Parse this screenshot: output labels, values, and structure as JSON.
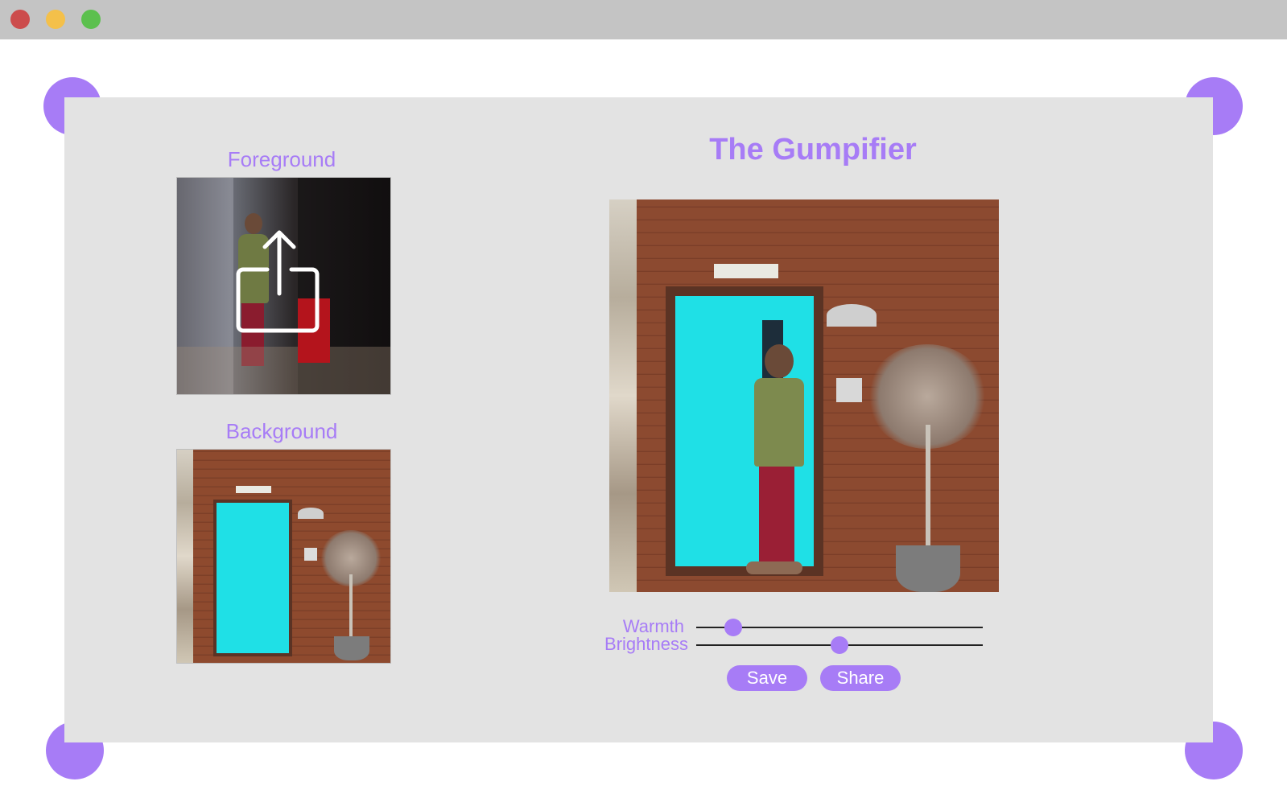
{
  "window": {
    "controls": [
      "close",
      "minimize",
      "maximize"
    ],
    "colors": {
      "close": "#cc4c4c",
      "minimize": "#f4c04a",
      "maximize": "#5cc04e"
    }
  },
  "app": {
    "title": "The Gumpifier",
    "accent_color": "#a77cf6",
    "panel_color": "#e3e3e3"
  },
  "foreground": {
    "label": "Foreground",
    "icon": "upload-icon"
  },
  "background": {
    "label": "Background"
  },
  "sliders": {
    "warmth": {
      "label": "Warmth",
      "value": 0.13
    },
    "brightness": {
      "label": "Brightness",
      "value": 0.5
    }
  },
  "actions": {
    "save_label": "Save",
    "share_label": "Share"
  }
}
